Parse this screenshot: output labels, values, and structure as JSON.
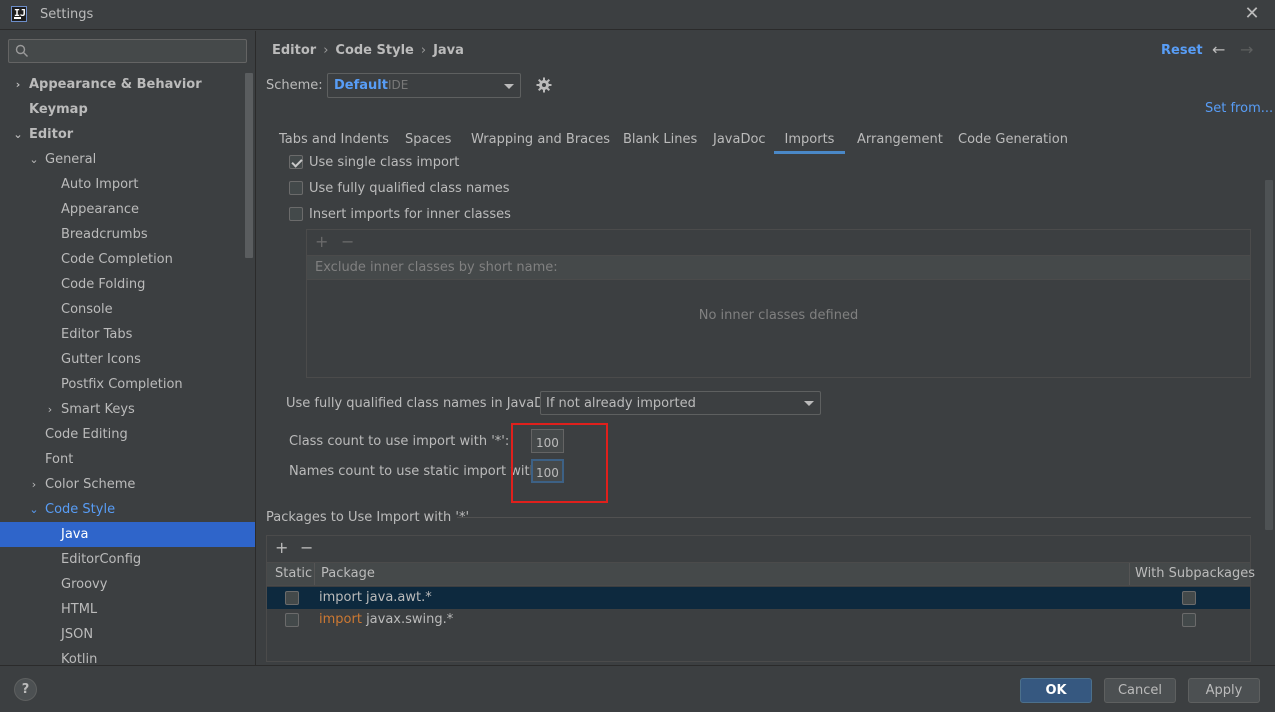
{
  "window": {
    "title": "Settings",
    "close_glyph": "✕"
  },
  "app_logo_text": "IJ",
  "search": {
    "placeholder": "",
    "value": ""
  },
  "sidebar": {
    "items": [
      {
        "label": "Appearance & Behavior",
        "chevron": "›"
      },
      {
        "label": "Keymap"
      },
      {
        "label": "Editor",
        "chevron": "⌄"
      },
      {
        "label": "General",
        "chevron": "⌄"
      },
      {
        "label": "Auto Import"
      },
      {
        "label": "Appearance"
      },
      {
        "label": "Breadcrumbs"
      },
      {
        "label": "Code Completion"
      },
      {
        "label": "Code Folding"
      },
      {
        "label": "Console"
      },
      {
        "label": "Editor Tabs"
      },
      {
        "label": "Gutter Icons"
      },
      {
        "label": "Postfix Completion"
      },
      {
        "label": "Smart Keys",
        "chevron": "›"
      },
      {
        "label": "Code Editing"
      },
      {
        "label": "Font"
      },
      {
        "label": "Color Scheme",
        "chevron": "›"
      },
      {
        "label": "Code Style",
        "chevron": "⌄"
      },
      {
        "label": "Java"
      },
      {
        "label": "EditorConfig"
      },
      {
        "label": "Groovy"
      },
      {
        "label": "HTML"
      },
      {
        "label": "JSON"
      },
      {
        "label": "Kotlin"
      }
    ]
  },
  "breadcrumb": {
    "items": [
      "Editor",
      "Code Style",
      "Java"
    ],
    "sep": "›"
  },
  "header": {
    "reset_label": "Reset",
    "back_glyph": "←",
    "forward_glyph": "→"
  },
  "scheme": {
    "label": "Scheme:",
    "name": "Default",
    "sub": "IDE",
    "set_from": "Set from..."
  },
  "tabs": [
    {
      "label": "Tabs and Indents"
    },
    {
      "label": "Spaces"
    },
    {
      "label": "Wrapping and Braces"
    },
    {
      "label": "Blank Lines"
    },
    {
      "label": "JavaDoc"
    },
    {
      "label": "Imports"
    },
    {
      "label": "Arrangement"
    },
    {
      "label": "Code Generation"
    }
  ],
  "options": {
    "single_class_import": {
      "label": "Use single class import",
      "checked": true
    },
    "fully_qualified": {
      "label": "Use fully qualified class names",
      "checked": false
    },
    "inner_classes": {
      "label": "Insert imports for inner classes",
      "checked": false
    }
  },
  "inner_panel": {
    "plus": "+",
    "minus": "−",
    "header": "Exclude inner classes by short name:",
    "empty_text": "No inner classes defined"
  },
  "javadoc": {
    "label": "Use fully qualified class names in JavaDoc:",
    "value": "If not already imported"
  },
  "counts": {
    "class_label": "Class count to use import with '*':",
    "class_value": "100",
    "static_label": "Names count to use static import with '*':",
    "static_value": "100"
  },
  "packages": {
    "title": "Packages to Use Import with '*'",
    "plus": "+",
    "minus": "−",
    "columns": [
      "Static",
      "Package",
      "With Subpackages"
    ],
    "rows": [
      {
        "keyword": "",
        "text": "import java.awt.*",
        "static": false,
        "subpackages": false,
        "selected": true
      },
      {
        "keyword": "import",
        "text": " javax.swing.*",
        "static": false,
        "subpackages": false,
        "selected": false
      }
    ]
  },
  "footer": {
    "help": "?",
    "ok": "OK",
    "cancel": "Cancel",
    "apply": "Apply"
  },
  "colors": {
    "accent": "#589df6",
    "selection": "#2f65ca",
    "highlight": "#e0201c",
    "keyword": "#cc7832"
  }
}
